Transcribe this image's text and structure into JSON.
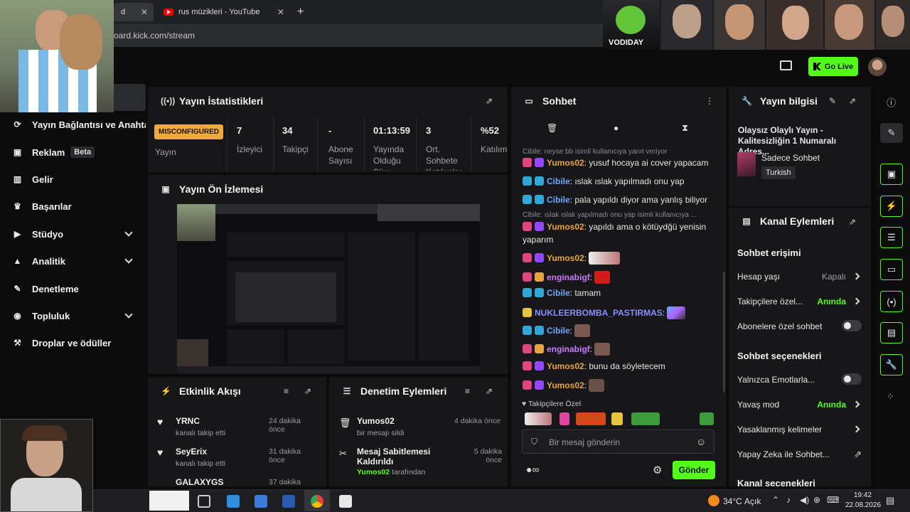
{
  "browser": {
    "tabs": [
      {
        "label": "d"
      },
      {
        "label": "rus müzikleri - YouTube"
      }
    ],
    "new_tab": "+",
    "url": "oard.kick.com/stream"
  },
  "header": {
    "go_live": "Go Live"
  },
  "sidebar": {
    "items": [
      {
        "label": "Yayın Bağlantısı ve Anahtarı",
        "icon": "link-icon"
      },
      {
        "label": "Reklam",
        "badge": "Beta",
        "icon": "ad-icon"
      },
      {
        "label": "Gelir",
        "icon": "bar-chart-icon"
      },
      {
        "label": "Başarılar",
        "icon": "trophy-icon"
      },
      {
        "label": "Stüdyo",
        "icon": "studio-icon"
      },
      {
        "label": "Analitik",
        "icon": "analytics-icon"
      },
      {
        "label": "Denetleme",
        "icon": "wrench-icon"
      },
      {
        "label": "Topluluk",
        "icon": "community-icon"
      },
      {
        "label": "Droplar ve ödüller",
        "icon": "drops-icon"
      }
    ]
  },
  "stats": {
    "title": "Yayın İstatistikleri",
    "status_badge": "MISCONFIGURED",
    "status_label": "Yayın",
    "items": [
      {
        "value": "7",
        "label": "İzleyici"
      },
      {
        "value": "34",
        "label": "Takipçi"
      },
      {
        "value": "-",
        "label": "Abone Sayısı"
      },
      {
        "value": "01:13:59",
        "label": "Yayında Olduğu Süre"
      },
      {
        "value": "3",
        "label": "Ort. Sohbete Katılanlar"
      },
      {
        "value": "%52",
        "label": "Katılım"
      }
    ]
  },
  "preview": {
    "title": "Yayın Ön İzlemesi"
  },
  "events": {
    "title": "Etkinlik Akışı",
    "items": [
      {
        "name": "YRNC",
        "action": "kanalı takip etti",
        "time": "24 dakika önce"
      },
      {
        "name": "SeyErix",
        "action": "kanalı takip etti",
        "time": "31 dakika önce"
      },
      {
        "name": "GALAXYGS",
        "action": "",
        "time": "37 dakika önce"
      }
    ]
  },
  "moderation": {
    "title": "Denetim Eylemleri",
    "items": [
      {
        "name": "Yumos02",
        "action": "bir mesajı sildi",
        "time": "4 dakika önce"
      },
      {
        "name": "Mesaj Sabitlemesi Kaldırıldı",
        "user": "Yumos02",
        "suffix": "tarafından",
        "time": "5 dakika önce"
      }
    ]
  },
  "chat": {
    "title": "Sohbet",
    "messages": [
      {
        "type": "reply",
        "text": "Cibile: neyse bb isimli kullanıcıya yanıt veriyor"
      },
      {
        "user": "Yumos02",
        "color": "#e8a53d",
        "text": "yusuf hocaya ai cover yapacam"
      },
      {
        "user": "Cibile",
        "color": "#6ea7ff",
        "text": "ıslak ıslak yapılmadı onu yap"
      },
      {
        "user": "Cibile",
        "color": "#6ea7ff",
        "text": "pala yapıldı diyor ama yanlış biliyor"
      },
      {
        "type": "reply",
        "text": "Cibile: ıslak ıslak yapılmadı onu yap isimli kullanıcıya ..."
      },
      {
        "user": "Yumos02",
        "color": "#e8a53d",
        "text": "yapıldı ama o kötüydğü yenisin"
      },
      {
        "type": "cont",
        "text": "yaparım"
      },
      {
        "user": "Yumos02",
        "color": "#e8a53d",
        "text": ""
      },
      {
        "user": "enginabigf",
        "color": "#c97bff",
        "text": ""
      },
      {
        "user": "Cibile",
        "color": "#6ea7ff",
        "text": "tamam"
      },
      {
        "user": "NUKLEERBOMBA_PASTIRMAS",
        "color": "#8a8cff",
        "text": ""
      },
      {
        "user": "Cibile",
        "color": "#6ea7ff",
        "text": ""
      },
      {
        "user": "enginabigf",
        "color": "#c97bff",
        "text": ""
      },
      {
        "user": "Yumos02",
        "color": "#e8a53d",
        "text": "bunu da söyletecem"
      },
      {
        "user": "Yumos02",
        "color": "#e8a53d",
        "text": ""
      }
    ],
    "followers_only": "Takipçilere Özel",
    "input_placeholder": "Bir mesaj gönderin",
    "send": "Gönder"
  },
  "stream_info": {
    "title": "Yayın bilgisi",
    "stream_title": "Olaysız Olaylı Yayın - Kalitesizliğin 1 Numaralı Adres...",
    "category": "Sadece Sohbet",
    "language": "Turkish"
  },
  "channel_actions": {
    "title": "Kanal Eylemleri",
    "chat_access": "Sohbet erişimi",
    "rows1": [
      {
        "label": "Hesap yaşı",
        "value": "Kapalı",
        "value_color": "#a0a0a4"
      },
      {
        "label": "Takipçilere özel...",
        "value": "Anında",
        "value_color": "#53fc18"
      },
      {
        "label": "Abonelere özel sohbet",
        "toggle": true
      }
    ],
    "chat_options": "Sohbet seçenekleri",
    "rows2": [
      {
        "label": "Yalnızca Emotlarla...",
        "toggle": true
      },
      {
        "label": "Yavaş mod",
        "value": "Anında",
        "value_color": "#53fc18"
      },
      {
        "label": "Yasaklanmış kelimeler",
        "value": ""
      },
      {
        "label": "Yapay Zeka ile Sohbet...",
        "value": ""
      }
    ],
    "cut": "Kanal seçenekleri"
  },
  "taskbar": {
    "weather": "34°C",
    "weather_desc": "Açık",
    "time": "19:42",
    "date": "22.08.2026"
  },
  "webcam": {
    "label": "VODIDAY"
  },
  "colors": {
    "accent": "#53fc18",
    "panel": "#17171a",
    "background": "#0b0b0c",
    "warning": "#f0a93b"
  }
}
